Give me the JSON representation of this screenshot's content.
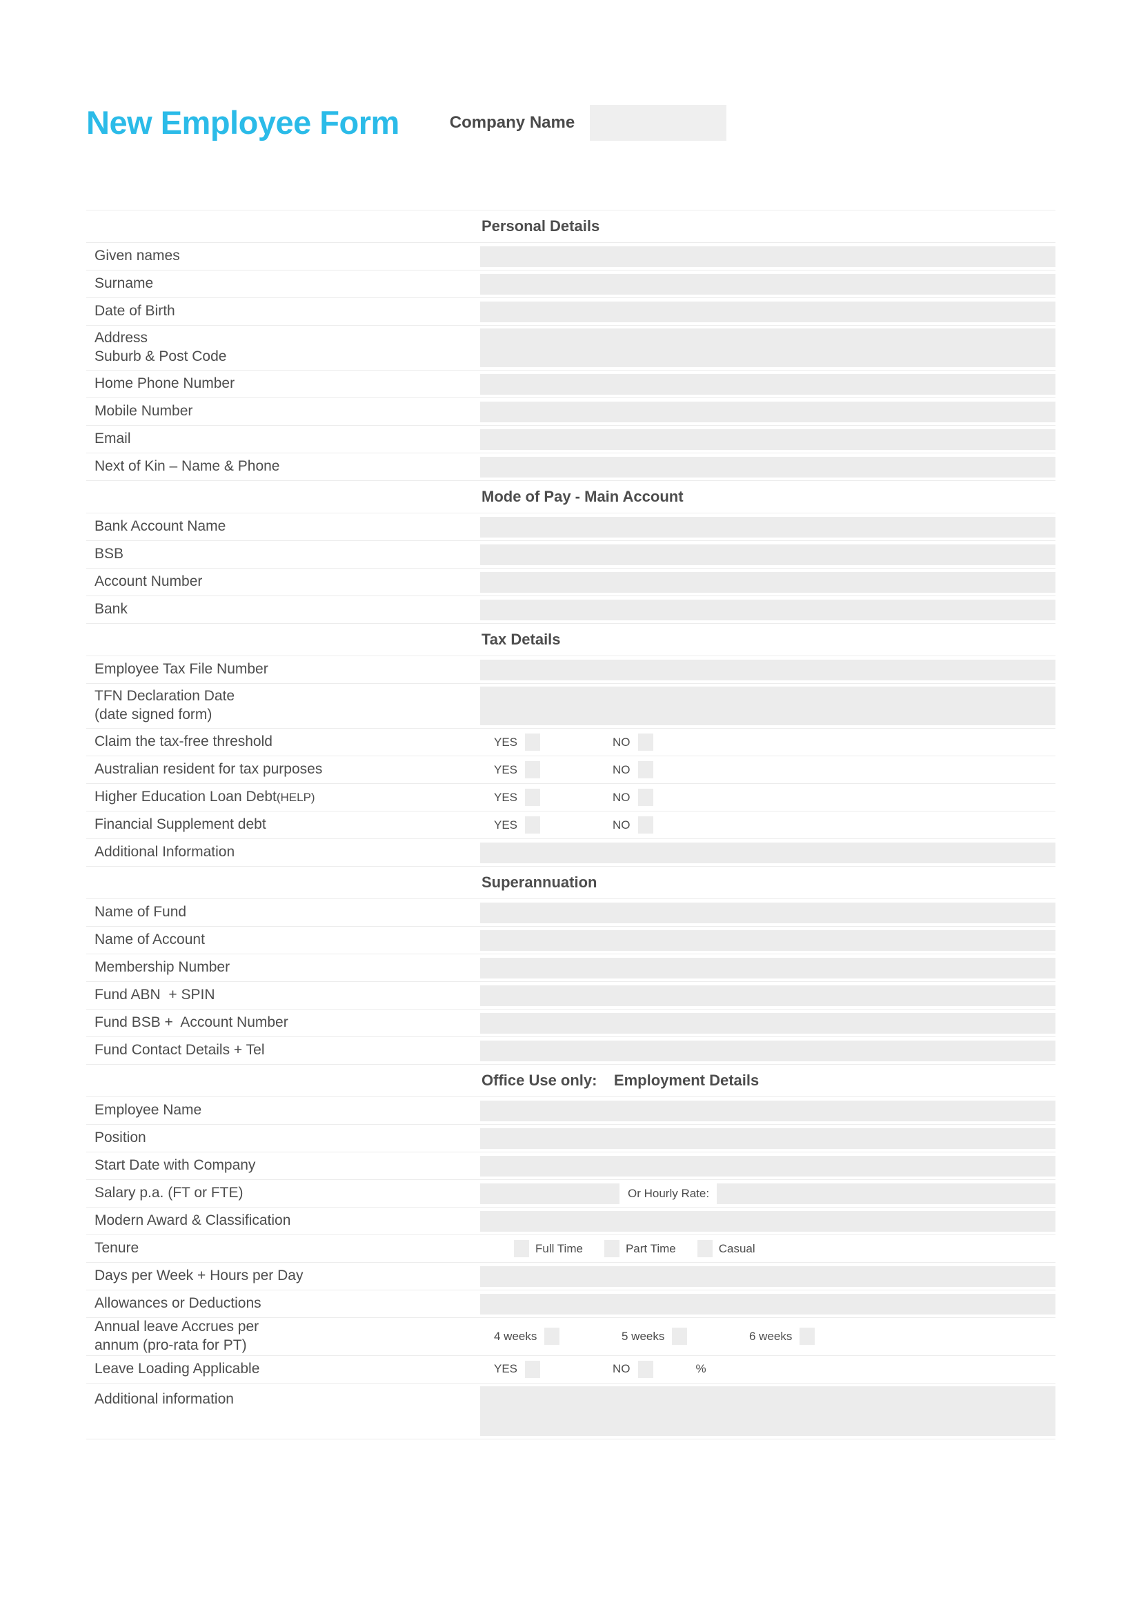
{
  "header": {
    "title": "New Employee Form",
    "company_label": "Company Name",
    "company_value": "",
    "title_color": "#2BBBE8"
  },
  "sections": [
    {
      "title": "Personal Details",
      "rows": [
        {
          "label": "Given names",
          "type": "field"
        },
        {
          "label": "Surname",
          "type": "field"
        },
        {
          "label": "Date of Birth",
          "type": "field"
        },
        {
          "label": "Address\nSuburb & Post Code",
          "type": "field-tall"
        },
        {
          "label": "Home Phone Number",
          "type": "field"
        },
        {
          "label": "Mobile Number",
          "type": "field"
        },
        {
          "label": "Email",
          "type": "field"
        },
        {
          "label": "Next of Kin – Name & Phone",
          "type": "field"
        }
      ]
    },
    {
      "title": "Mode of Pay - Main Account",
      "rows": [
        {
          "label": "Bank Account Name",
          "type": "field"
        },
        {
          "label": "BSB",
          "type": "field"
        },
        {
          "label": "Account Number",
          "type": "field"
        },
        {
          "label": "Bank",
          "type": "field"
        }
      ]
    },
    {
      "title": "Tax Details",
      "rows": [
        {
          "label": "Employee Tax File Number",
          "type": "field"
        },
        {
          "label": "TFN Declaration Date\n(date signed form)",
          "type": "field-tall"
        },
        {
          "label": "Claim the tax-free threshold",
          "type": "yesno"
        },
        {
          "label": "Australian resident for tax purposes",
          "type": "yesno"
        },
        {
          "label": "Higher Education Loan Debt (HELP)",
          "label_small_suffix": "(HELP)",
          "label_main": "Higher Education Loan Debt ",
          "type": "yesno"
        },
        {
          "label": "Financial Supplement debt",
          "type": "yesno"
        },
        {
          "label": "Additional Information",
          "type": "field"
        }
      ]
    },
    {
      "title": "Superannuation",
      "rows": [
        {
          "label": "Name of Fund",
          "type": "field"
        },
        {
          "label": "Name of Account",
          "type": "field"
        },
        {
          "label": "Membership Number",
          "type": "field"
        },
        {
          "label": "Fund ABN  + SPIN",
          "type": "field"
        },
        {
          "label": "Fund BSB +  Account Number",
          "type": "field"
        },
        {
          "label": "Fund Contact Details + Tel",
          "type": "field"
        }
      ]
    },
    {
      "title": "Office Use only:    Employment Details",
      "rows": [
        {
          "label": "Employee Name",
          "type": "field"
        },
        {
          "label": "Position",
          "type": "field"
        },
        {
          "label": "Start Date with Company",
          "type": "field"
        },
        {
          "label": "Salary p.a. (FT or FTE)",
          "type": "salary"
        },
        {
          "label": "Modern Award & Classification",
          "type": "field"
        },
        {
          "label": "Tenure",
          "type": "tenure"
        },
        {
          "label": "Days per Week + Hours per Day",
          "type": "field"
        },
        {
          "label": "Allowances or Deductions",
          "type": "field"
        },
        {
          "label": "Annual leave Accrues per\nannum (pro-rata for PT)",
          "type": "weeks"
        },
        {
          "label": "Leave Loading Applicable",
          "type": "yesno-pct"
        },
        {
          "label": "Additional information",
          "type": "field-xtall"
        }
      ]
    }
  ],
  "options": {
    "yes": "YES",
    "no": "NO",
    "percent": "%",
    "weeks_4": "4 weeks",
    "weeks_5": "5 weeks",
    "weeks_6": "6 weeks",
    "full_time": "Full Time",
    "part_time": "Part Time",
    "casual": "Casual",
    "or_hourly_rate": "Or Hourly Rate:"
  }
}
